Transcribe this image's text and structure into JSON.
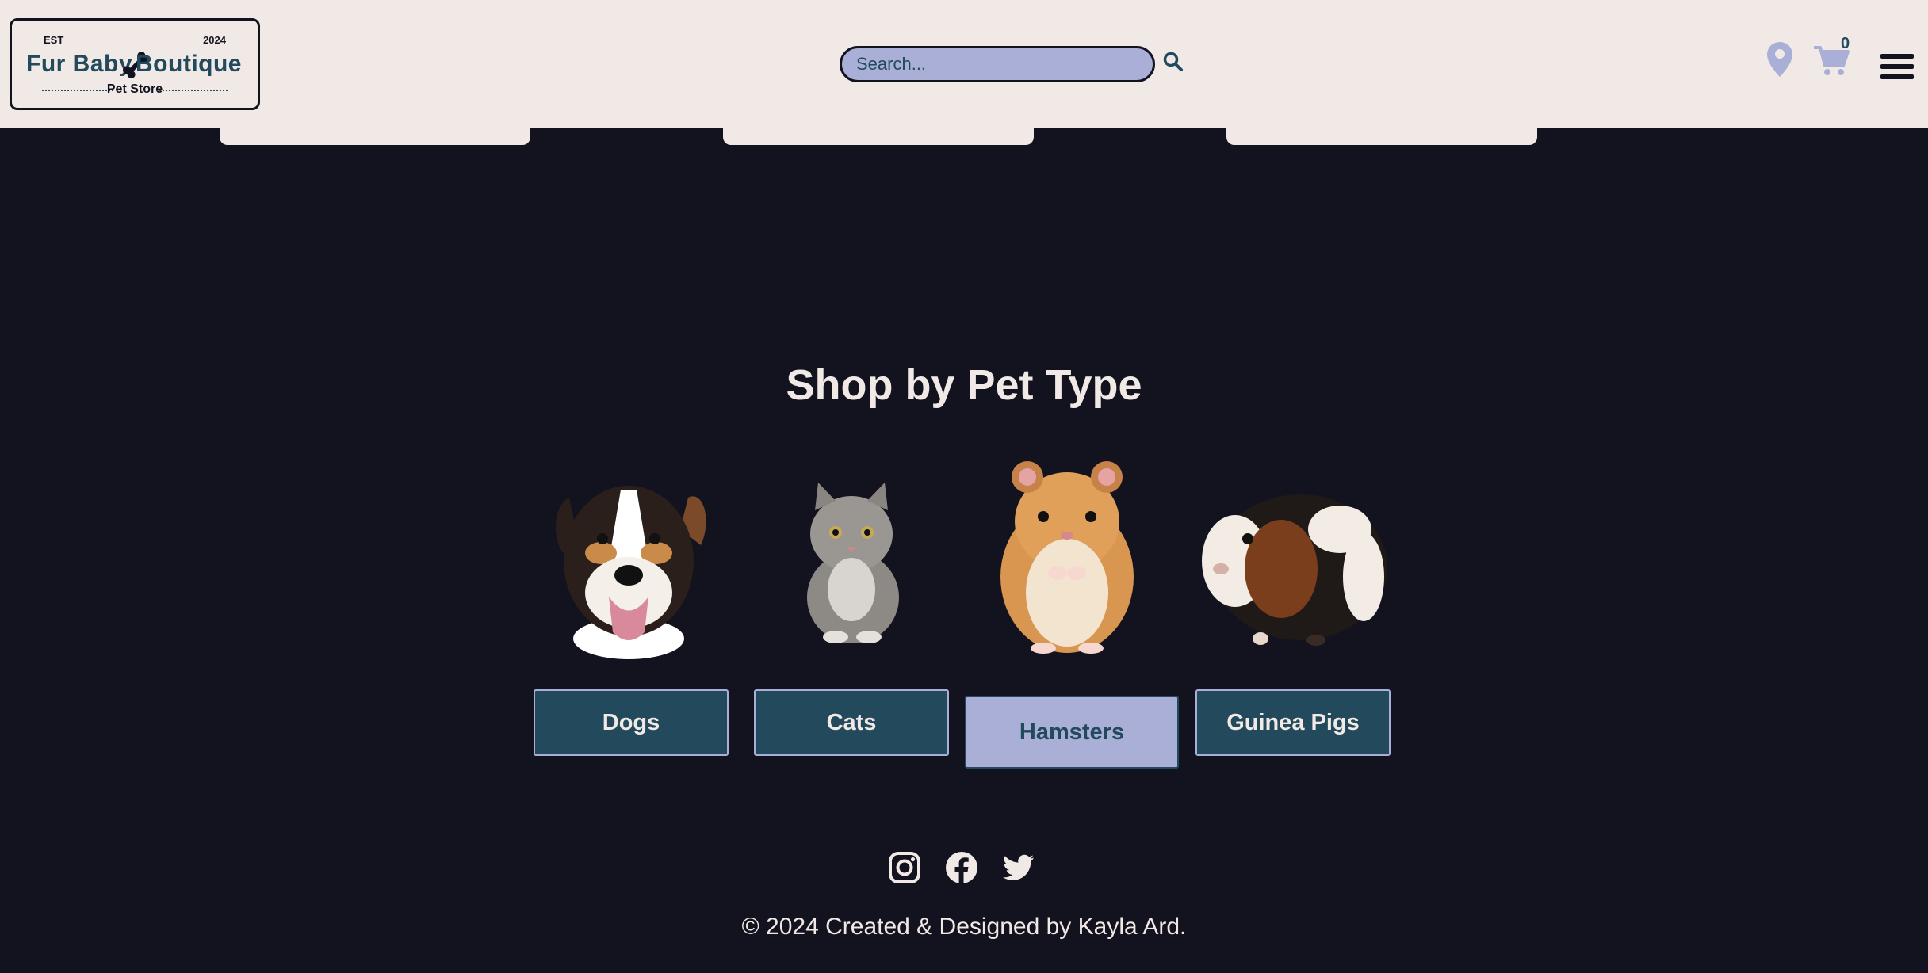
{
  "header": {
    "logo": {
      "est": "EST",
      "year": "2024",
      "name_left": "Fur Baby",
      "name_right": "Boutique",
      "subtitle": "Pet Store",
      "icon": "bone-icon"
    },
    "search": {
      "placeholder": "Search...",
      "value": "",
      "icon": "search-icon"
    },
    "icons": {
      "location": "location-pin-icon",
      "cart": "cart-icon",
      "menu": "hamburger-menu-icon"
    },
    "cart_count": "0"
  },
  "main": {
    "title": "Shop by Pet Type",
    "pets": [
      {
        "label": "Dogs",
        "image": "dog-image"
      },
      {
        "label": "Cats",
        "image": "cat-image"
      },
      {
        "label": "Hamsters",
        "image": "hamster-image"
      },
      {
        "label": "Guinea Pigs",
        "image": "guinea-pig-image"
      }
    ],
    "active_pet": "Hamsters"
  },
  "footer": {
    "social": [
      "instagram-icon",
      "facebook-icon",
      "twitter-icon"
    ],
    "copyright": "© 2024 Created & Designed by Kayla Ard."
  },
  "colors": {
    "background": "#13121f",
    "header_bg": "#f1e9e6",
    "accent_teal": "#22495c",
    "accent_lavender": "#a9afd6",
    "text_light": "#f1e9e6"
  }
}
